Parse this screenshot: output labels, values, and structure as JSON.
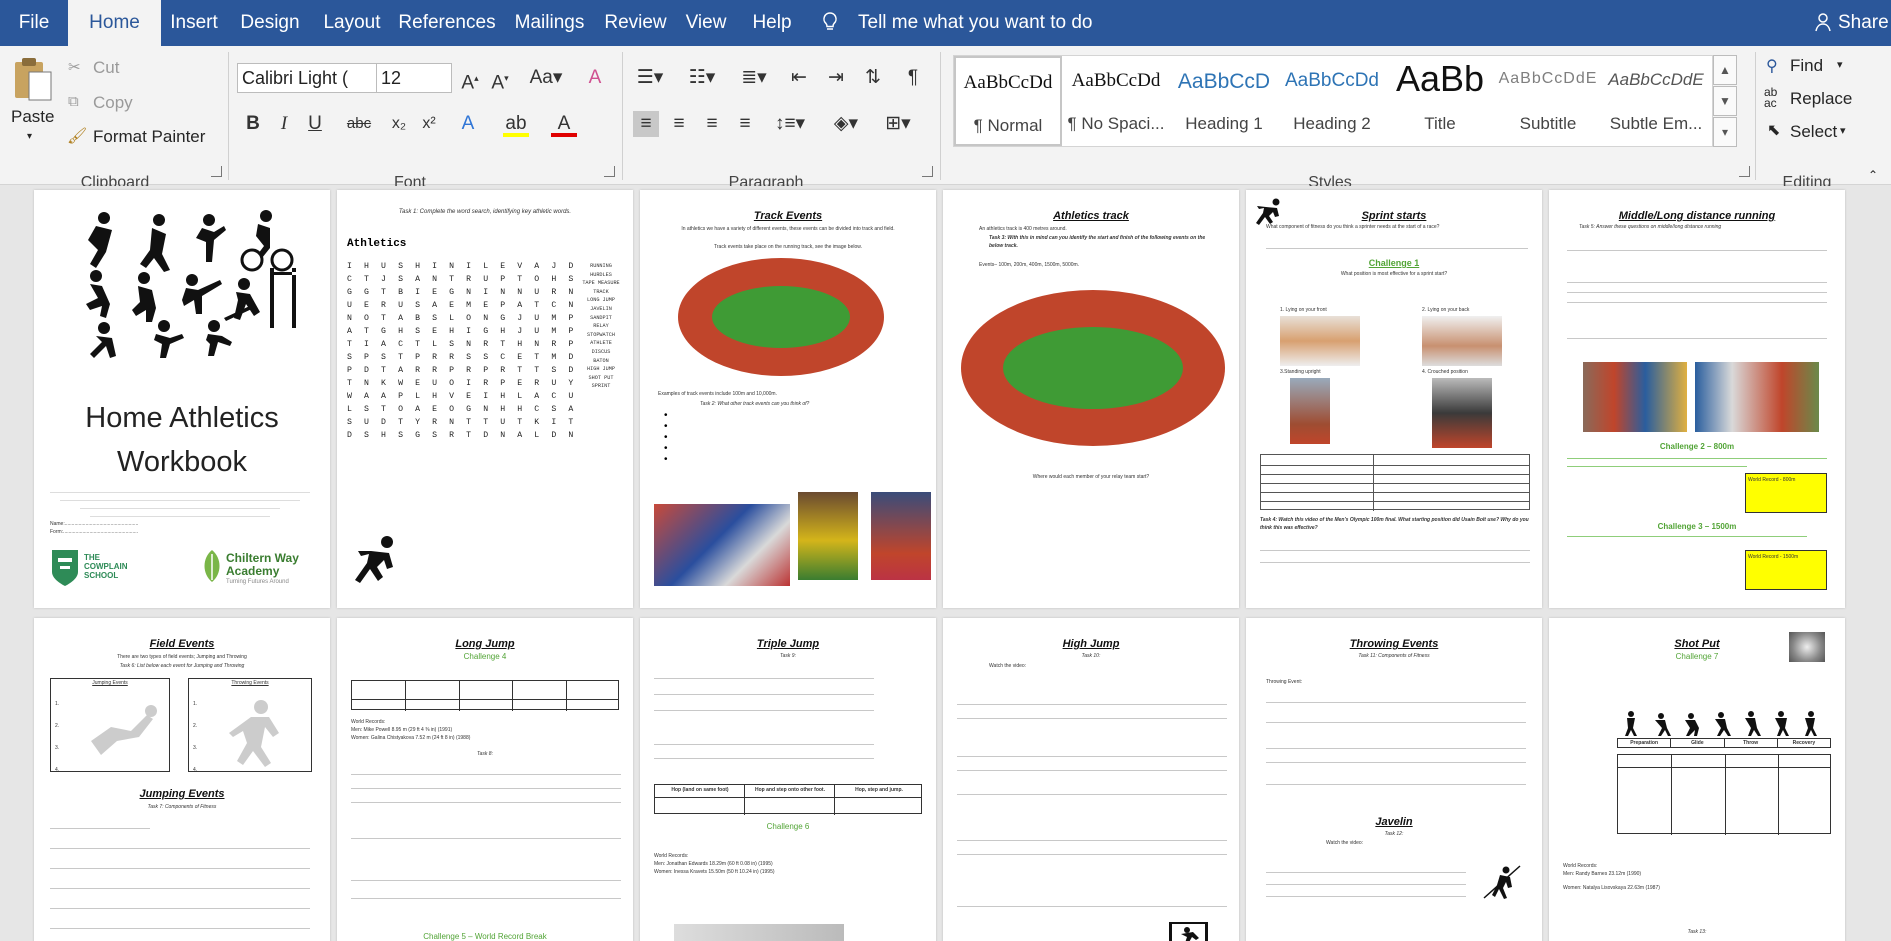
{
  "tabs": [
    "File",
    "Home",
    "Insert",
    "Design",
    "Layout",
    "References",
    "Mailings",
    "Review",
    "View",
    "Help"
  ],
  "tell_me": "Tell me what you want to do",
  "share": "Share",
  "clipboard": {
    "paste": "Paste",
    "cut": "Cut",
    "copy": "Copy",
    "format_painter": "Format Painter",
    "group": "Clipboard"
  },
  "font": {
    "name": "Calibri Light (",
    "size": "12",
    "group": "Font"
  },
  "paragraph": {
    "group": "Paragraph"
  },
  "styles": {
    "group": "Styles",
    "items": [
      {
        "preview": "AaBbCcDd",
        "name": "¶ Normal"
      },
      {
        "preview": "AaBbCcDd",
        "name": "¶ No Spaci..."
      },
      {
        "preview": "AaBbCcD",
        "name": "Heading 1"
      },
      {
        "preview": "AaBbCcDd",
        "name": "Heading 2"
      },
      {
        "preview": "AaBb",
        "name": "Title"
      },
      {
        "preview": "AaBbCcDdE",
        "name": "Subtitle"
      },
      {
        "preview": "AaBbCcDdE",
        "name": "Subtle Em..."
      }
    ]
  },
  "editing": {
    "find": "Find",
    "replace": "Replace",
    "select": "Select",
    "group": "Editing"
  },
  "pages": {
    "p1": {
      "title": "Home Athletics Workbook",
      "school1": "THE COWPLAIN SCHOOL",
      "school2": "Chiltern Way Academy",
      "tagline": "Turning Futures Around",
      "name": "Name:.....................................................",
      "form": "Form:......................................................"
    },
    "p2": {
      "task": "Task 1: Complete the word search, identifying key athletic words.",
      "heading": "Athletics",
      "grid": [
        "IHUSHINILEVAJD",
        "CTJSANTRUPTOHS",
        "GGTBIEGNINNURN",
        "UERUSAEMEPATCN",
        "NOTABSLONGJUMP",
        "ATGHSEHIGHJUMP",
        "TIACTLSNRTHNRP",
        "SPSTPRRSSCETMD",
        "PDTARRPRPRTTSD",
        "TNKWEUOIRPERUY",
        "WAAPLHVEIHLACU",
        "LSTOAEOGNHHCSA",
        "SUDTYRNTTUTKIT",
        "DSHSGSRTDNALDN"
      ],
      "words": [
        "RUNNING",
        "HURDLES",
        "TAPE MEASURE",
        "TRACK",
        "LONG JUMP",
        "JAVELIN",
        "SANDPIT",
        "RELAY",
        "STOPWATCH",
        "ATHLETE",
        "DISCUS",
        "BATON",
        "HIGH JUMP",
        "SHOT PUT",
        "SPRINT"
      ]
    },
    "p3": {
      "title": "Track Events",
      "intro": "In athletics we have a variety of different events, these events can be divided into track and field.",
      "intro2": "Track events take place on the running track, see the image below.",
      "examples": "Examples of track events include 100m and 10,000m.",
      "task": "Task 2: What other track events can you think of?"
    },
    "p4": {
      "title": "Athletics track",
      "intro": "An athletics track is 400 metres around.",
      "task": "Task 3: With this in mind can you identify the start and finish of the following events on the below track.",
      "events": "Events– 100m, 200m, 400m, 1500m, 5000m.",
      "question": "Where would each member of your relay team start?"
    },
    "p5": {
      "title": "Sprint starts",
      "q": "What component of fitness do you think a sprinter needs at the start of a race?",
      "challenge": "Challenge 1",
      "sub": "What position is most effective for a sprint start?",
      "labels": [
        "1. Lying on your front",
        "2. Lying on your back",
        "3.Standing upright",
        "4. Crouched position"
      ],
      "task": "Task 4: Watch this video of the Men's Olympic 100m final. What starting position did Usain Bolt use? Why do you think this was effective?"
    },
    "p6": {
      "title": "Middle/Long distance running",
      "task": "Task 5: Answer these questions on middle/long distance running",
      "c2": "Challenge 2 – 800m",
      "c3": "Challenge 3 – 1500m",
      "wr": "World Record - 800m",
      "wr2": "World Record - 1500m"
    },
    "p7": {
      "title": "Field Events",
      "intro": "There are two types of field events; Jumping and Throwing",
      "task": "Task 6: List below each event for Jumping and Throwing",
      "col1": "Jumping Events",
      "col2": "Throwing Events",
      "title2": "Jumping Events",
      "task2": "Task 7: Components of Fitness"
    },
    "p8": {
      "title": "Long Jump",
      "c4": "Challenge 4",
      "task": "Task 8:",
      "c5": "Challenge 5 – World Record Break",
      "records": "World Records:",
      "men": "Men: Mike Powell 8.95 m (29 ft 4 ⅜ in) (1991)",
      "women": "Women: Galina Chistyakova 7.52 m (24 ft 8 in) (1988)"
    },
    "p9": {
      "title": "Triple Jump",
      "task": "Task 9:",
      "c6": "Challenge 6",
      "h1": "Hop (land on same foot)",
      "h2": "Hop and step onto other foot.",
      "h3": "Hop, step and jump.",
      "records": "World Records:",
      "men": "Men: Jonathan Edwards 18.29m (60 ft 0.08 in) (1995)",
      "women": "Women: Inessa Kravets 15.50m (50 ft 10.24 in) (1995)"
    },
    "p10": {
      "title": "High Jump",
      "task": "Task 10:",
      "video": "Watch the video:"
    },
    "p11": {
      "title": "Throwing Events",
      "task": "Task 11: Components of Fitness",
      "title2": "Javelin",
      "task2": "Task 12:",
      "video": "Watch the video:",
      "throwing": "Throwing Event:"
    },
    "p12": {
      "title": "Shot Put",
      "c7": "Challenge 7",
      "task": "Task 13:",
      "records": "World Records:",
      "men": "Men: Randy Barnes 23.12m (1990)",
      "women": "Women: Natalya Lisovskaya 22.63m (1987)",
      "phases": [
        "Preparation",
        "Glide",
        "Throw",
        "Recovery"
      ]
    }
  },
  "colors": {
    "ribbon_blue": "#2b579a",
    "task_red": "#c00000",
    "challenge_green": "#52a436",
    "track": "#c0452b",
    "field": "#3f9b35"
  }
}
